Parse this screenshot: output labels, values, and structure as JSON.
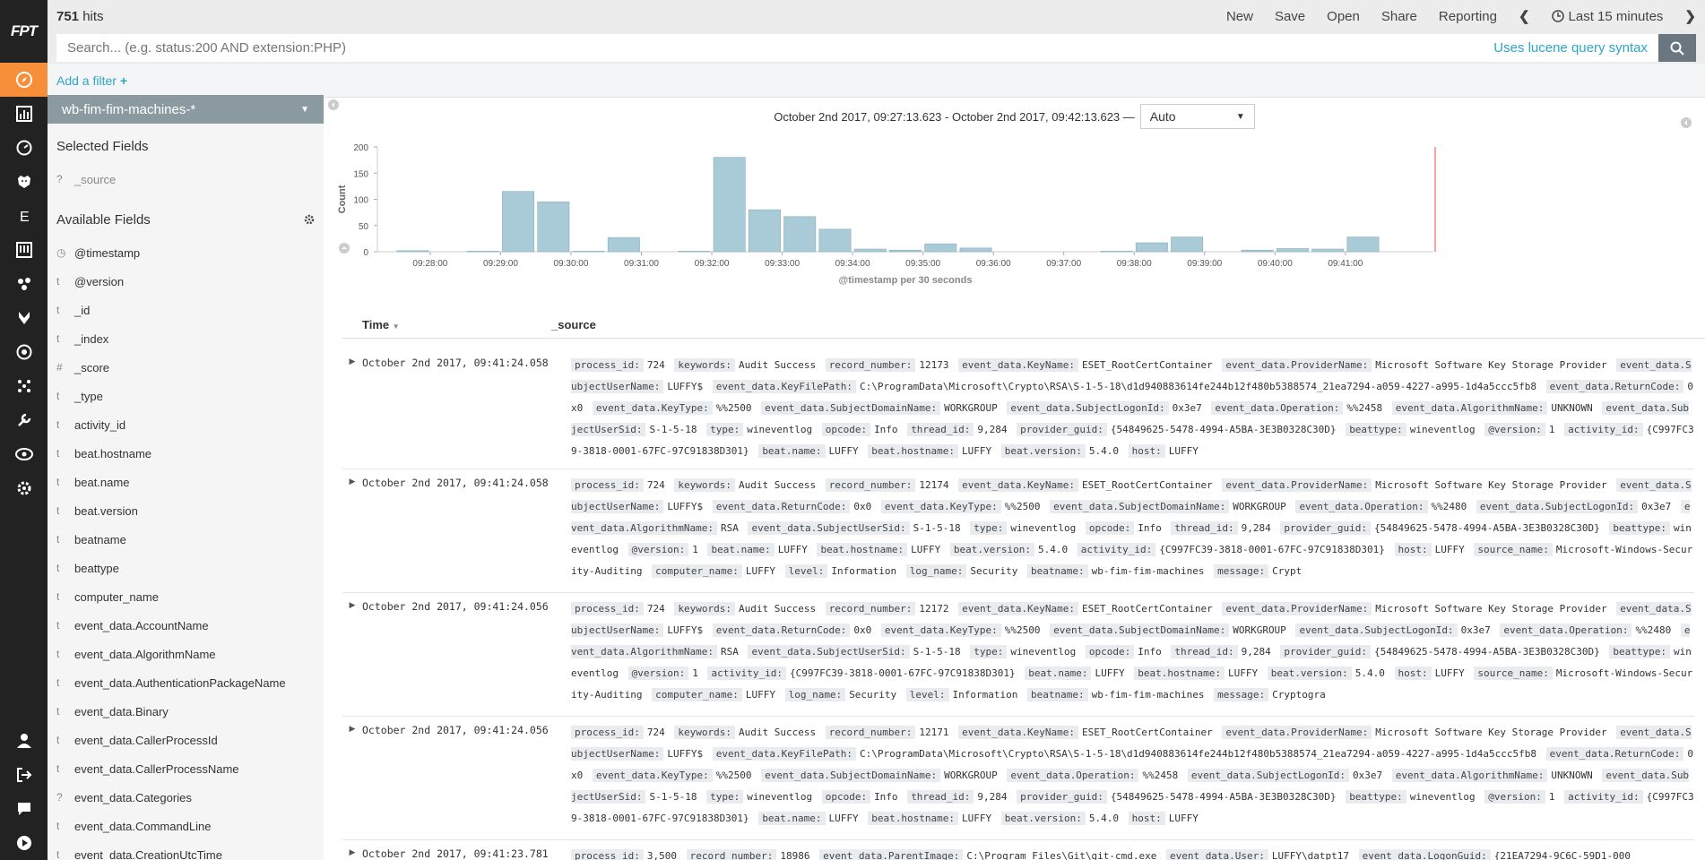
{
  "app": {
    "logo": "FPT"
  },
  "topbar": {
    "hits_count": "751",
    "hits_label": " hits",
    "links": [
      "New",
      "Save",
      "Open",
      "Share",
      "Reporting"
    ],
    "time_label": "Last 15 minutes"
  },
  "search": {
    "placeholder": "Search... (e.g. status:200 AND extension:PHP)",
    "lucene_label": "Uses lucene query syntax"
  },
  "filter": {
    "add_label": "Add a filter"
  },
  "sidebar": {
    "index_pattern": "wb-fim-fim-machines-*",
    "selected_title": "Selected Fields",
    "selected_fields": [
      {
        "type": "?",
        "name": "_source"
      }
    ],
    "available_title": "Available Fields",
    "available_fields": [
      {
        "type": "◷",
        "name": "@timestamp"
      },
      {
        "type": "t",
        "name": "@version"
      },
      {
        "type": "t",
        "name": "_id"
      },
      {
        "type": "t",
        "name": "_index"
      },
      {
        "type": "#",
        "name": "_score"
      },
      {
        "type": "t",
        "name": "_type"
      },
      {
        "type": "t",
        "name": "activity_id"
      },
      {
        "type": "t",
        "name": "beat.hostname"
      },
      {
        "type": "t",
        "name": "beat.name"
      },
      {
        "type": "t",
        "name": "beat.version"
      },
      {
        "type": "t",
        "name": "beatname"
      },
      {
        "type": "t",
        "name": "beattype"
      },
      {
        "type": "t",
        "name": "computer_name"
      },
      {
        "type": "t",
        "name": "event_data.AccountName"
      },
      {
        "type": "t",
        "name": "event_data.AlgorithmName"
      },
      {
        "type": "t",
        "name": "event_data.AuthenticationPackageName"
      },
      {
        "type": "t",
        "name": "event_data.Binary"
      },
      {
        "type": "t",
        "name": "event_data.CallerProcessId"
      },
      {
        "type": "t",
        "name": "event_data.CallerProcessName"
      },
      {
        "type": "?",
        "name": "event_data.Categories"
      },
      {
        "type": "t",
        "name": "event_data.CommandLine"
      },
      {
        "type": "t",
        "name": "event_data.CreationUtcTime"
      }
    ]
  },
  "histogram": {
    "range_text": "October 2nd 2017, 09:27:13.623 - October 2nd 2017, 09:42:13.623 —",
    "interval": "Auto"
  },
  "chart_data": {
    "type": "bar",
    "title": "",
    "xlabel": "@timestamp per 30 seconds",
    "ylabel": "Count",
    "ylim": [
      0,
      200
    ],
    "yticks": [
      0,
      50,
      100,
      150,
      200
    ],
    "xticks": [
      "09:28:00",
      "09:29:00",
      "09:30:00",
      "09:31:00",
      "09:32:00",
      "09:33:00",
      "09:34:00",
      "09:35:00",
      "09:36:00",
      "09:37:00",
      "09:38:00",
      "09:39:00",
      "09:40:00",
      "09:41:00"
    ],
    "categories": [
      "09:27:30",
      "09:28:00",
      "09:28:30",
      "09:29:00",
      "09:29:30",
      "09:30:00",
      "09:30:30",
      "09:31:00",
      "09:31:30",
      "09:32:00",
      "09:32:30",
      "09:33:00",
      "09:33:30",
      "09:34:00",
      "09:34:30",
      "09:35:00",
      "09:35:30",
      "09:36:00",
      "09:36:30",
      "09:37:00",
      "09:37:30",
      "09:38:00",
      "09:38:30",
      "09:39:00",
      "09:39:30",
      "09:40:00",
      "09:40:30",
      "09:41:00",
      "09:41:30"
    ],
    "values": [
      2,
      0,
      1,
      115,
      95,
      1,
      27,
      0,
      1,
      180,
      80,
      67,
      43,
      5,
      3,
      15,
      7,
      0,
      0,
      0,
      1,
      17,
      28,
      0,
      3,
      6,
      5,
      28,
      0
    ]
  },
  "table": {
    "col_time": "Time",
    "col_source": "_source",
    "rows": [
      {
        "time": "October 2nd 2017, 09:41:24.058",
        "fields": [
          [
            "process_id:",
            "724"
          ],
          [
            "keywords:",
            "Audit Success"
          ],
          [
            "record_number:",
            "12173"
          ],
          [
            "event_data.KeyName:",
            "ESET_RootCertContainer"
          ],
          [
            "event_data.ProviderName:",
            "Microsoft Software Key Storage Provider"
          ],
          [
            "event_data.SubjectUserName:",
            "LUFFY$"
          ],
          [
            "event_data.KeyFilePath:",
            "C:\\ProgramData\\Microsoft\\Crypto\\RSA\\S-1-5-18\\d1d940883614fe244b12f480b5388574_21ea7294-a059-4227-a995-1d4a5ccc5fb8"
          ],
          [
            "event_data.ReturnCode:",
            "0x0"
          ],
          [
            "event_data.KeyType:",
            "%%2500"
          ],
          [
            "event_data.SubjectDomainName:",
            "WORKGROUP"
          ],
          [
            "event_data.SubjectLogonId:",
            "0x3e7"
          ],
          [
            "event_data.Operation:",
            "%%2458"
          ],
          [
            "event_data.AlgorithmName:",
            "UNKNOWN"
          ],
          [
            "event_data.SubjectUserSid:",
            "S-1-5-18"
          ],
          [
            "type:",
            "wineventlog"
          ],
          [
            "opcode:",
            "Info"
          ],
          [
            "thread_id:",
            "9,284"
          ],
          [
            "provider_guid:",
            "{54849625-5478-4994-A5BA-3E3B0328C30D}"
          ],
          [
            "beattype:",
            "wineventlog"
          ],
          [
            "@version:",
            "1"
          ],
          [
            "activity_id:",
            "{C997FC39-3818-0001-67FC-97C91838D301}"
          ],
          [
            "beat.name:",
            "LUFFY"
          ],
          [
            "beat.hostname:",
            "LUFFY"
          ],
          [
            "beat.version:",
            "5.4.0"
          ],
          [
            "host:",
            "LUFFY"
          ]
        ]
      },
      {
        "time": "October 2nd 2017, 09:41:24.058",
        "fields": [
          [
            "process_id:",
            "724"
          ],
          [
            "keywords:",
            "Audit Success"
          ],
          [
            "record_number:",
            "12174"
          ],
          [
            "event_data.KeyName:",
            "ESET_RootCertContainer"
          ],
          [
            "event_data.ProviderName:",
            "Microsoft Software Key Storage Provider"
          ],
          [
            "event_data.SubjectUserName:",
            "LUFFY$"
          ],
          [
            "event_data.ReturnCode:",
            "0x0"
          ],
          [
            "event_data.KeyType:",
            "%%2500"
          ],
          [
            "event_data.SubjectDomainName:",
            "WORKGROUP"
          ],
          [
            "event_data.Operation:",
            "%%2480"
          ],
          [
            "event_data.SubjectLogonId:",
            "0x3e7"
          ],
          [
            "event_data.AlgorithmName:",
            "RSA"
          ],
          [
            "event_data.SubjectUserSid:",
            "S-1-5-18"
          ],
          [
            "type:",
            "wineventlog"
          ],
          [
            "opcode:",
            "Info"
          ],
          [
            "thread_id:",
            "9,284"
          ],
          [
            "provider_guid:",
            "{54849625-5478-4994-A5BA-3E3B0328C30D}"
          ],
          [
            "beattype:",
            "wineventlog"
          ],
          [
            "@version:",
            "1"
          ],
          [
            "beat.name:",
            "LUFFY"
          ],
          [
            "beat.hostname:",
            "LUFFY"
          ],
          [
            "beat.version:",
            "5.4.0"
          ],
          [
            "activity_id:",
            "{C997FC39-3818-0001-67FC-97C91838D301}"
          ],
          [
            "host:",
            "LUFFY"
          ],
          [
            "source_name:",
            "Microsoft-Windows-Security-Auditing"
          ],
          [
            "computer_name:",
            "LUFFY"
          ],
          [
            "level:",
            "Information"
          ],
          [
            "log_name:",
            "Security"
          ],
          [
            "beatname:",
            "wb-fim-fim-machines"
          ],
          [
            "message:",
            "Crypt"
          ]
        ]
      },
      {
        "time": "October 2nd 2017, 09:41:24.056",
        "fields": [
          [
            "process_id:",
            "724"
          ],
          [
            "keywords:",
            "Audit Success"
          ],
          [
            "record_number:",
            "12172"
          ],
          [
            "event_data.KeyName:",
            "ESET_RootCertContainer"
          ],
          [
            "event_data.ProviderName:",
            "Microsoft Software Key Storage Provider"
          ],
          [
            "event_data.SubjectUserName:",
            "LUFFY$"
          ],
          [
            "event_data.ReturnCode:",
            "0x0"
          ],
          [
            "event_data.KeyType:",
            "%%2500"
          ],
          [
            "event_data.SubjectDomainName:",
            "WORKGROUP"
          ],
          [
            "event_data.SubjectLogonId:",
            "0x3e7"
          ],
          [
            "event_data.Operation:",
            "%%2480"
          ],
          [
            "event_data.AlgorithmName:",
            "RSA"
          ],
          [
            "event_data.SubjectUserSid:",
            "S-1-5-18"
          ],
          [
            "type:",
            "wineventlog"
          ],
          [
            "opcode:",
            "Info"
          ],
          [
            "thread_id:",
            "9,284"
          ],
          [
            "provider_guid:",
            "{54849625-5478-4994-A5BA-3E3B0328C30D}"
          ],
          [
            "beattype:",
            "wineventlog"
          ],
          [
            "@version:",
            "1"
          ],
          [
            "activity_id:",
            "{C997FC39-3818-0001-67FC-97C91838D301}"
          ],
          [
            "beat.name:",
            "LUFFY"
          ],
          [
            "beat.hostname:",
            "LUFFY"
          ],
          [
            "beat.version:",
            "5.4.0"
          ],
          [
            "host:",
            "LUFFY"
          ],
          [
            "source_name:",
            "Microsoft-Windows-Security-Auditing"
          ],
          [
            "computer_name:",
            "LUFFY"
          ],
          [
            "log_name:",
            "Security"
          ],
          [
            "level:",
            "Information"
          ],
          [
            "beatname:",
            "wb-fim-fim-machines"
          ],
          [
            "message:",
            "Cryptogra"
          ]
        ]
      },
      {
        "time": "October 2nd 2017, 09:41:24.056",
        "fields": [
          [
            "process_id:",
            "724"
          ],
          [
            "keywords:",
            "Audit Success"
          ],
          [
            "record_number:",
            "12171"
          ],
          [
            "event_data.KeyName:",
            "ESET_RootCertContainer"
          ],
          [
            "event_data.ProviderName:",
            "Microsoft Software Key Storage Provider"
          ],
          [
            "event_data.SubjectUserName:",
            "LUFFY$"
          ],
          [
            "event_data.KeyFilePath:",
            "C:\\ProgramData\\Microsoft\\Crypto\\RSA\\S-1-5-18\\d1d940883614fe244b12f480b5388574_21ea7294-a059-4227-a995-1d4a5ccc5fb8"
          ],
          [
            "event_data.ReturnCode:",
            "0x0"
          ],
          [
            "event_data.KeyType:",
            "%%2500"
          ],
          [
            "event_data.SubjectDomainName:",
            "WORKGROUP"
          ],
          [
            "event_data.Operation:",
            "%%2458"
          ],
          [
            "event_data.SubjectLogonId:",
            "0x3e7"
          ],
          [
            "event_data.AlgorithmName:",
            "UNKNOWN"
          ],
          [
            "event_data.SubjectUserSid:",
            "S-1-5-18"
          ],
          [
            "type:",
            "wineventlog"
          ],
          [
            "opcode:",
            "Info"
          ],
          [
            "thread_id:",
            "9,284"
          ],
          [
            "provider_guid:",
            "{54849625-5478-4994-A5BA-3E3B0328C30D}"
          ],
          [
            "beattype:",
            "wineventlog"
          ],
          [
            "@version:",
            "1"
          ],
          [
            "activity_id:",
            "{C997FC39-3818-0001-67FC-97C91838D301}"
          ],
          [
            "beat.name:",
            "LUFFY"
          ],
          [
            "beat.hostname:",
            "LUFFY"
          ],
          [
            "beat.version:",
            "5.4.0"
          ],
          [
            "host:",
            "LUFFY"
          ]
        ]
      },
      {
        "time": "October 2nd 2017, 09:41:23.781",
        "fields": [
          [
            "process_id:",
            "3,500"
          ],
          [
            "record_number:",
            "18986"
          ],
          [
            "event_data.ParentImage:",
            "C:\\Program Files\\Git\\git-cmd.exe"
          ],
          [
            "event_data.User:",
            "LUFFY\\datpt17"
          ],
          [
            "event_data.LogonGuid:",
            "{21EA7294-9C6C-59D1-000"
          ]
        ]
      }
    ]
  }
}
